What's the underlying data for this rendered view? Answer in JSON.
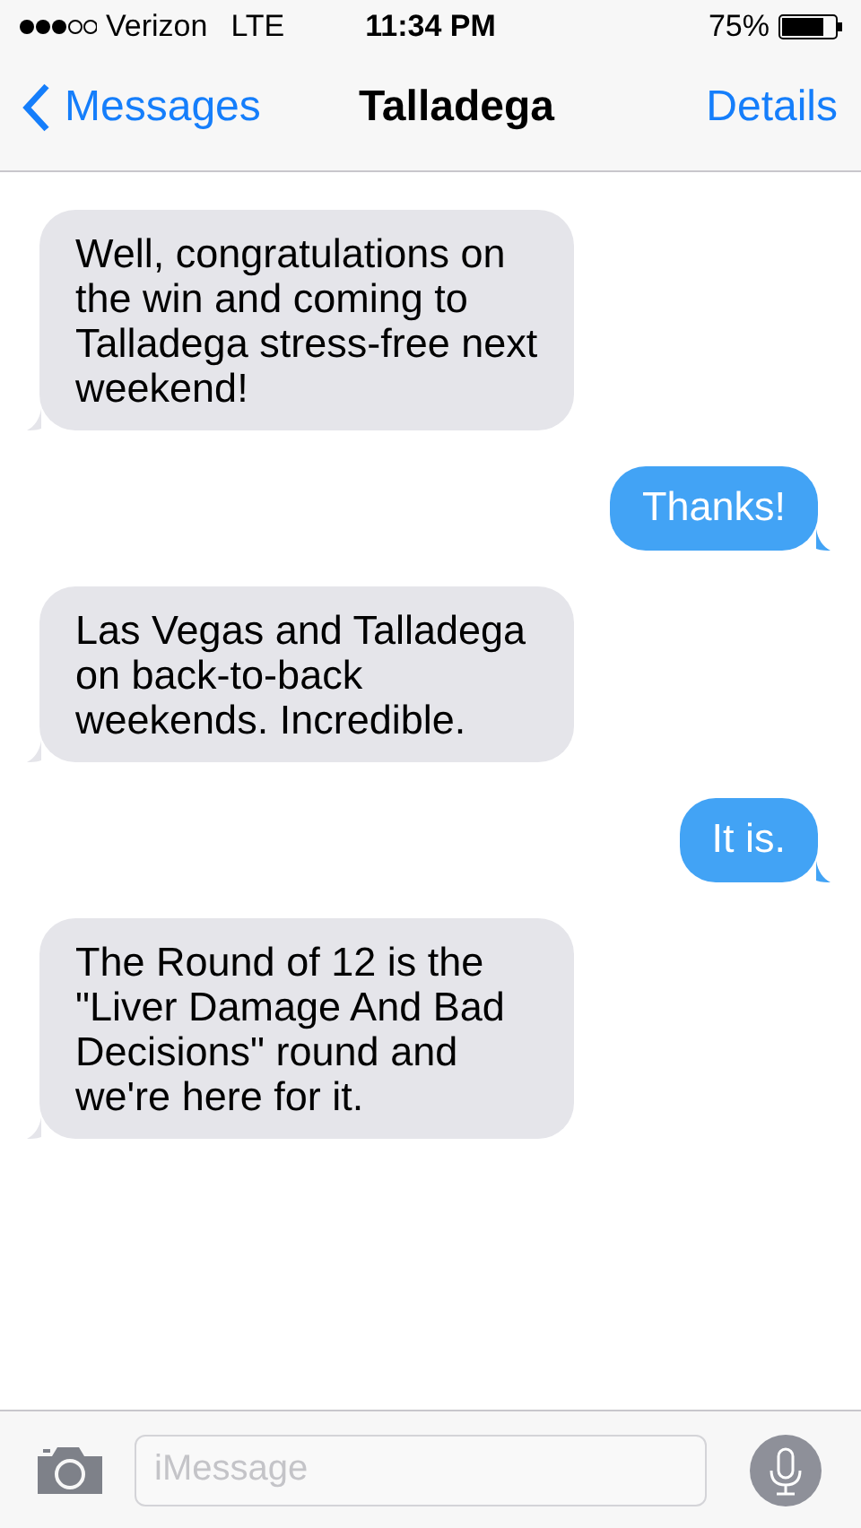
{
  "status_bar": {
    "carrier": "Verizon",
    "network": "LTE",
    "time": "11:34 PM",
    "battery": "75%"
  },
  "nav": {
    "back": "Messages",
    "title": "Talladega",
    "action": "Details"
  },
  "messages": [
    {
      "kind": "received",
      "text": "Well, congratulations on the win and coming to Talladega stress-free next weekend!"
    },
    {
      "kind": "sent",
      "text": "Thanks!"
    },
    {
      "kind": "received",
      "text": "Las Vegas and Talladega on back-to-back weekends. Incredible."
    },
    {
      "kind": "sent",
      "text": "It is."
    },
    {
      "kind": "received",
      "text": "The Round of 12 is the \"Liver Damage And Bad Decisions\" round and we're here for it."
    }
  ],
  "composer": {
    "placeholder": "iMessage"
  }
}
